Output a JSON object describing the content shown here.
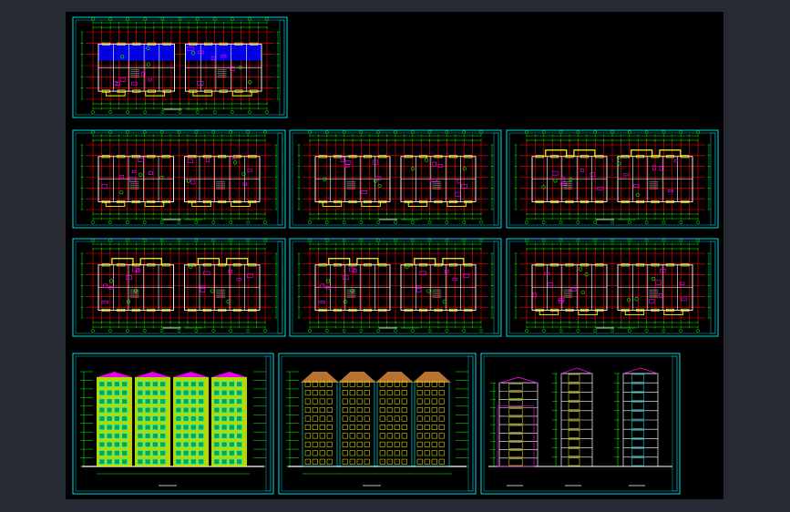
{
  "colors": {
    "app_background": "#262b33",
    "canvas_background": "#000000",
    "frame": "#00c8d2",
    "dimension": "#00ff00",
    "grid_axis": "#ff0000",
    "wall": "#ffffff",
    "window": "#ffff00",
    "furniture": "#ff00ff",
    "fill_plan": "#0000ff",
    "roof": "#b87333",
    "facade_fill": "#d4ff00",
    "facade_window": "#00ffff"
  },
  "sheets": [
    {
      "kind": "plan",
      "name": "plan-sheet-1",
      "variant": 0
    },
    {
      "kind": "plan",
      "name": "plan-sheet-2",
      "variant": 1
    },
    {
      "kind": "plan",
      "name": "plan-sheet-3",
      "variant": 2
    },
    {
      "kind": "plan",
      "name": "plan-sheet-4",
      "variant": 3
    },
    {
      "kind": "plan",
      "name": "plan-sheet-5",
      "variant": 4
    },
    {
      "kind": "plan",
      "name": "plan-sheet-6",
      "variant": 4
    },
    {
      "kind": "plan",
      "name": "plan-sheet-7",
      "variant": 5
    },
    {
      "kind": "elevation",
      "name": "elevation-sheet-1",
      "variant": 0
    },
    {
      "kind": "elevation",
      "name": "elevation-sheet-2",
      "variant": 1
    },
    {
      "kind": "section",
      "name": "section-sheet",
      "variant": 0
    }
  ]
}
